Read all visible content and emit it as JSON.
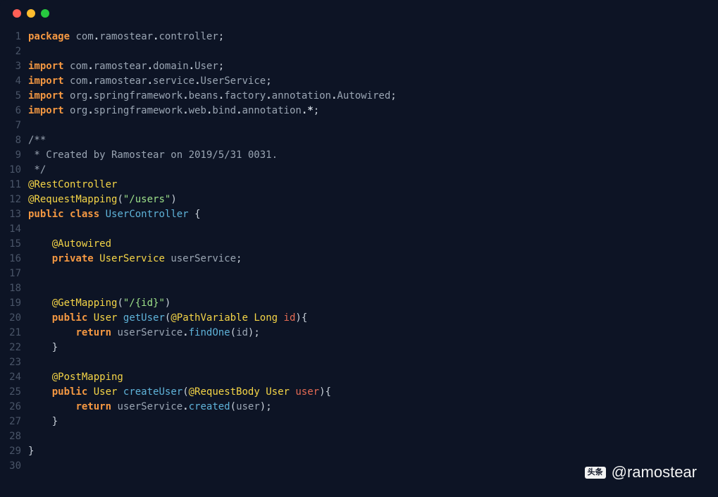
{
  "watermark": {
    "icon_text": "头条",
    "handle": "@ramostear"
  },
  "code_lines": [
    {
      "n": 1,
      "t": [
        [
          "kw",
          "package"
        ],
        [
          "sp",
          " "
        ],
        [
          "pkg",
          "com"
        ],
        [
          "dot2",
          "."
        ],
        [
          "pkg",
          "ramostear"
        ],
        [
          "dot2",
          "."
        ],
        [
          "pkg",
          "controller"
        ],
        [
          "semi",
          ";"
        ]
      ]
    },
    {
      "n": 2,
      "t": []
    },
    {
      "n": 3,
      "t": [
        [
          "kw",
          "import"
        ],
        [
          "sp",
          " "
        ],
        [
          "pkg",
          "com"
        ],
        [
          "dot2",
          "."
        ],
        [
          "pkg",
          "ramostear"
        ],
        [
          "dot2",
          "."
        ],
        [
          "pkg",
          "domain"
        ],
        [
          "dot2",
          "."
        ],
        [
          "pkg",
          "User"
        ],
        [
          "semi",
          ";"
        ]
      ]
    },
    {
      "n": 4,
      "t": [
        [
          "kw",
          "import"
        ],
        [
          "sp",
          " "
        ],
        [
          "pkg",
          "com"
        ],
        [
          "dot2",
          "."
        ],
        [
          "pkg",
          "ramostear"
        ],
        [
          "dot2",
          "."
        ],
        [
          "pkg",
          "service"
        ],
        [
          "dot2",
          "."
        ],
        [
          "pkg",
          "UserService"
        ],
        [
          "semi",
          ";"
        ]
      ]
    },
    {
      "n": 5,
      "t": [
        [
          "kw",
          "import"
        ],
        [
          "sp",
          " "
        ],
        [
          "pkg",
          "org"
        ],
        [
          "dot2",
          "."
        ],
        [
          "pkg",
          "springframework"
        ],
        [
          "dot2",
          "."
        ],
        [
          "pkg",
          "beans"
        ],
        [
          "dot2",
          "."
        ],
        [
          "pkg",
          "factory"
        ],
        [
          "dot2",
          "."
        ],
        [
          "pkg",
          "annotation"
        ],
        [
          "dot2",
          "."
        ],
        [
          "pkg",
          "Autowired"
        ],
        [
          "semi",
          ";"
        ]
      ]
    },
    {
      "n": 6,
      "t": [
        [
          "kw",
          "import"
        ],
        [
          "sp",
          " "
        ],
        [
          "pkg",
          "org"
        ],
        [
          "dot2",
          "."
        ],
        [
          "pkg",
          "springframework"
        ],
        [
          "dot2",
          "."
        ],
        [
          "pkg",
          "web"
        ],
        [
          "dot2",
          "."
        ],
        [
          "pkg",
          "bind"
        ],
        [
          "dot2",
          "."
        ],
        [
          "pkg",
          "annotation"
        ],
        [
          "dot2",
          "."
        ],
        [
          "op",
          "*"
        ],
        [
          "semi",
          ";"
        ]
      ]
    },
    {
      "n": 7,
      "t": []
    },
    {
      "n": 8,
      "t": [
        [
          "cmt",
          "/**"
        ]
      ]
    },
    {
      "n": 9,
      "t": [
        [
          "cmt",
          " * Created by Ramostear on 2019/5/31 0031."
        ]
      ]
    },
    {
      "n": 10,
      "t": [
        [
          "cmt",
          " */"
        ]
      ]
    },
    {
      "n": 11,
      "t": [
        [
          "ann",
          "@RestController"
        ]
      ]
    },
    {
      "n": 12,
      "t": [
        [
          "ann",
          "@RequestMapping"
        ],
        [
          "paren",
          "("
        ],
        [
          "str",
          "\"/users\""
        ],
        [
          "paren",
          ")"
        ]
      ]
    },
    {
      "n": 13,
      "t": [
        [
          "kw",
          "public"
        ],
        [
          "sp",
          " "
        ],
        [
          "kw",
          "class"
        ],
        [
          "sp",
          " "
        ],
        [
          "type",
          "UserController"
        ],
        [
          "sp",
          " "
        ],
        [
          "brace",
          "{"
        ]
      ]
    },
    {
      "n": 14,
      "t": []
    },
    {
      "n": 15,
      "t": [
        [
          "sp",
          "    "
        ],
        [
          "ann",
          "@Autowired"
        ]
      ]
    },
    {
      "n": 16,
      "t": [
        [
          "sp",
          "    "
        ],
        [
          "kw",
          "private"
        ],
        [
          "sp",
          " "
        ],
        [
          "cls",
          "UserService"
        ],
        [
          "sp",
          " "
        ],
        [
          "pkg",
          "userService"
        ],
        [
          "semi",
          ";"
        ]
      ]
    },
    {
      "n": 17,
      "t": []
    },
    {
      "n": 18,
      "t": []
    },
    {
      "n": 19,
      "t": [
        [
          "sp",
          "    "
        ],
        [
          "ann",
          "@GetMapping"
        ],
        [
          "paren",
          "("
        ],
        [
          "str",
          "\"/{id}\""
        ],
        [
          "paren",
          ")"
        ]
      ]
    },
    {
      "n": 20,
      "t": [
        [
          "sp",
          "    "
        ],
        [
          "kw",
          "public"
        ],
        [
          "sp",
          " "
        ],
        [
          "cls",
          "User"
        ],
        [
          "sp",
          " "
        ],
        [
          "fn",
          "getUser"
        ],
        [
          "paren",
          "("
        ],
        [
          "ann",
          "@PathVariable"
        ],
        [
          "sp",
          " "
        ],
        [
          "cls",
          "Long"
        ],
        [
          "sp",
          " "
        ],
        [
          "param",
          "id"
        ],
        [
          "paren",
          ")"
        ],
        [
          "brace",
          "{"
        ]
      ]
    },
    {
      "n": 21,
      "t": [
        [
          "sp",
          "        "
        ],
        [
          "kw",
          "return"
        ],
        [
          "sp",
          " "
        ],
        [
          "pkg",
          "userService"
        ],
        [
          "dot2",
          "."
        ],
        [
          "fn",
          "findOne"
        ],
        [
          "paren",
          "("
        ],
        [
          "pkg",
          "id"
        ],
        [
          "paren",
          ")"
        ],
        [
          "semi",
          ";"
        ]
      ]
    },
    {
      "n": 22,
      "t": [
        [
          "sp",
          "    "
        ],
        [
          "brace",
          "}"
        ]
      ]
    },
    {
      "n": 23,
      "t": []
    },
    {
      "n": 24,
      "t": [
        [
          "sp",
          "    "
        ],
        [
          "ann",
          "@PostMapping"
        ]
      ]
    },
    {
      "n": 25,
      "t": [
        [
          "sp",
          "    "
        ],
        [
          "kw",
          "public"
        ],
        [
          "sp",
          " "
        ],
        [
          "cls",
          "User"
        ],
        [
          "sp",
          " "
        ],
        [
          "fn",
          "createUser"
        ],
        [
          "paren",
          "("
        ],
        [
          "ann",
          "@RequestBody"
        ],
        [
          "sp",
          " "
        ],
        [
          "cls",
          "User"
        ],
        [
          "sp",
          " "
        ],
        [
          "param",
          "user"
        ],
        [
          "paren",
          ")"
        ],
        [
          "brace",
          "{"
        ]
      ]
    },
    {
      "n": 26,
      "t": [
        [
          "sp",
          "        "
        ],
        [
          "kw",
          "return"
        ],
        [
          "sp",
          " "
        ],
        [
          "pkg",
          "userService"
        ],
        [
          "dot2",
          "."
        ],
        [
          "fn",
          "created"
        ],
        [
          "paren",
          "("
        ],
        [
          "pkg",
          "user"
        ],
        [
          "paren",
          ")"
        ],
        [
          "semi",
          ";"
        ]
      ]
    },
    {
      "n": 27,
      "t": [
        [
          "sp",
          "    "
        ],
        [
          "brace",
          "}"
        ]
      ]
    },
    {
      "n": 28,
      "t": []
    },
    {
      "n": 29,
      "t": [
        [
          "brace",
          "}"
        ]
      ]
    },
    {
      "n": 30,
      "t": []
    }
  ]
}
